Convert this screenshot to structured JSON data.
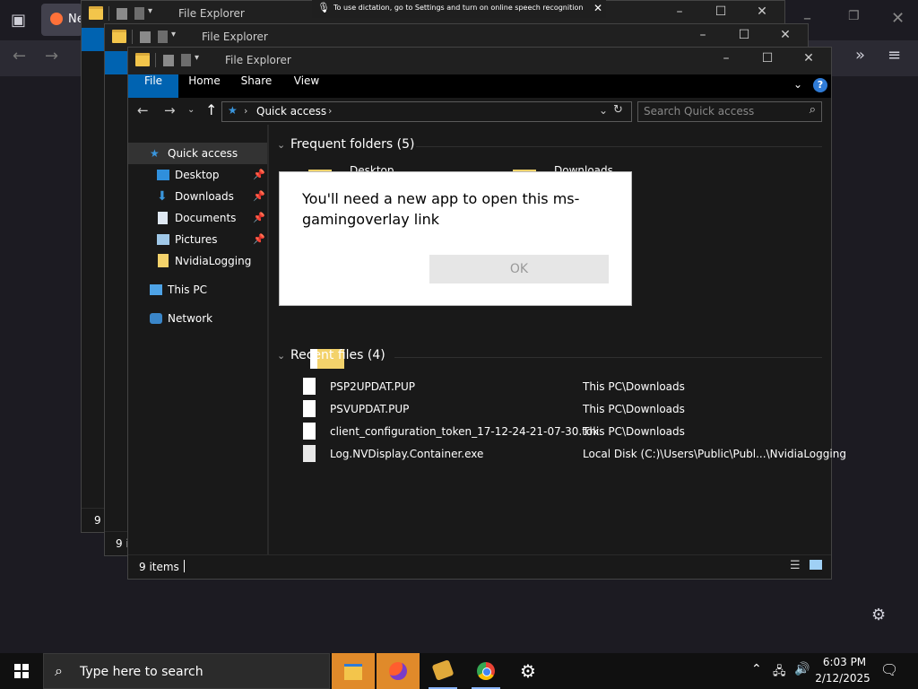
{
  "browser": {
    "tab_text": "Ne"
  },
  "dictation": {
    "text": "To use dictation, go to Settings and turn on online speech recognition"
  },
  "explorer": {
    "title": "File Explorer",
    "ribbon": {
      "file": "File",
      "home": "Home",
      "share": "Share",
      "view": "View"
    },
    "address": "Quick access",
    "search_placeholder": "Search Quick access",
    "nav": [
      {
        "label": "Quick access",
        "icon": "star-icon"
      },
      {
        "label": "Desktop",
        "icon": "desktop-icon"
      },
      {
        "label": "Downloads",
        "icon": "download-icon"
      },
      {
        "label": "Documents",
        "icon": "documents-icon"
      },
      {
        "label": "Pictures",
        "icon": "pictures-icon"
      },
      {
        "label": "NvidiaLogging",
        "icon": "folder-icon"
      },
      {
        "label": "This PC",
        "icon": "pc-icon"
      },
      {
        "label": "Network",
        "icon": "network-icon"
      }
    ],
    "frequent_header": "Frequent folders (5)",
    "frequent_partial": [
      "Desktop",
      "Downloads"
    ],
    "recent_header": "Recent files (4)",
    "recent_files": [
      {
        "name": "PSP2UPDAT.PUP",
        "location": "This PC\\Downloads"
      },
      {
        "name": "PSVUPDAT.PUP",
        "location": "This PC\\Downloads"
      },
      {
        "name": "client_configuration_token_17-12-24-21-07-30.tok",
        "location": "This PC\\Downloads"
      },
      {
        "name": "Log.NVDisplay.Container.exe",
        "location": "Local Disk (C:)\\Users\\Public\\Publ...\\NvidiaLogging"
      }
    ],
    "status_items": "9 items",
    "status_back": "9 i",
    "status_back2": "9 i"
  },
  "dialog": {
    "message": "You'll need a new app to open this ms-gamingoverlay link",
    "ok": "OK"
  },
  "taskbar": {
    "search_placeholder": "Type here to search",
    "time": "6:03 PM",
    "date": "2/12/2025"
  }
}
